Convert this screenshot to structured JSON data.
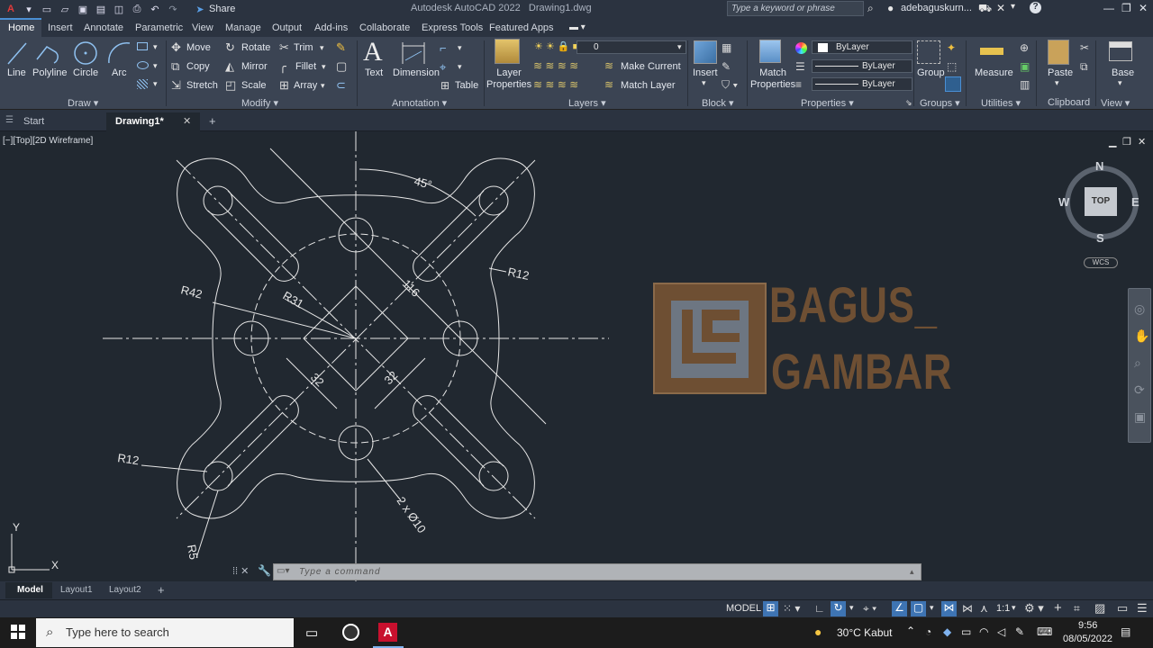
{
  "app": {
    "title": "Autodesk AutoCAD 2022",
    "file": "Drawing1.dwg",
    "share_label": "Share",
    "search_placeholder": "Type a keyword or phrase",
    "user": "adebaguskurn...",
    "help_icon": "?"
  },
  "ribbon_tabs": [
    "Home",
    "Insert",
    "Annotate",
    "Parametric",
    "View",
    "Manage",
    "Output",
    "Add-ins",
    "Collaborate",
    "Express Tools",
    "Featured Apps"
  ],
  "draw": {
    "title": "Draw",
    "line": "Line",
    "polyline": "Polyline",
    "circle": "Circle",
    "arc": "Arc"
  },
  "modify": {
    "title": "Modify",
    "move": "Move",
    "rotate": "Rotate",
    "trim": "Trim",
    "copy": "Copy",
    "mirror": "Mirror",
    "fillet": "Fillet",
    "stretch": "Stretch",
    "scale": "Scale",
    "array": "Array"
  },
  "annotation": {
    "title": "Annotation",
    "text": "Text",
    "dimension": "Dimension",
    "table": "Table"
  },
  "layers": {
    "title": "Layers",
    "layer_properties_1": "Layer",
    "layer_properties_2": "Properties",
    "current_layer": "0",
    "make_current": "Make Current",
    "match_layer": "Match Layer"
  },
  "block": {
    "title": "Block",
    "insert": "Insert"
  },
  "properties": {
    "title": "Properties",
    "match_1": "Match",
    "match_2": "Properties",
    "color": "ByLayer",
    "linetype": "ByLayer",
    "lineweight": "ByLayer"
  },
  "groups": {
    "title": "Groups",
    "group": "Group"
  },
  "utilities": {
    "title": "Utilities",
    "measure": "Measure"
  },
  "clipboard": {
    "title": "Clipboard",
    "paste": "Paste"
  },
  "view_panel": {
    "title": "View",
    "base": "Base"
  },
  "file_tabs": {
    "start": "Start",
    "drawing": "Drawing1*",
    "close": "✕",
    "add": "+"
  },
  "viewport": {
    "label": "[−][Top][2D Wireframe]",
    "compass": {
      "n": "N",
      "s": "S",
      "e": "E",
      "w": "W",
      "top": "TOP",
      "wcs": "WCS"
    },
    "ucs": {
      "x": "X",
      "y": "Y"
    }
  },
  "dimensions": {
    "angle": "45°",
    "r12_top": "R12",
    "r42": "R42",
    "r31": "R31",
    "len116": "116",
    "len32a": "32",
    "len32b": "32",
    "r12_bottom": "R12",
    "hole": "2 x Ø10",
    "r5": "R5"
  },
  "watermark": {
    "line1": "BAGUS_",
    "line2": "GAMBAR"
  },
  "command": {
    "placeholder": "Type a command"
  },
  "layout_tabs": [
    "Model",
    "Layout1",
    "Layout2"
  ],
  "status": {
    "model": "MODEL",
    "scale": "1:1"
  },
  "taskbar": {
    "search": "Type here to search",
    "weather": "30°C  Kabut",
    "time": "9:56",
    "date": "08/05/2022"
  },
  "colors": {
    "accent": "#4a8fd4",
    "canvas": "#212830",
    "ribbon": "#3b4453",
    "watermark": "#6e4f33"
  }
}
